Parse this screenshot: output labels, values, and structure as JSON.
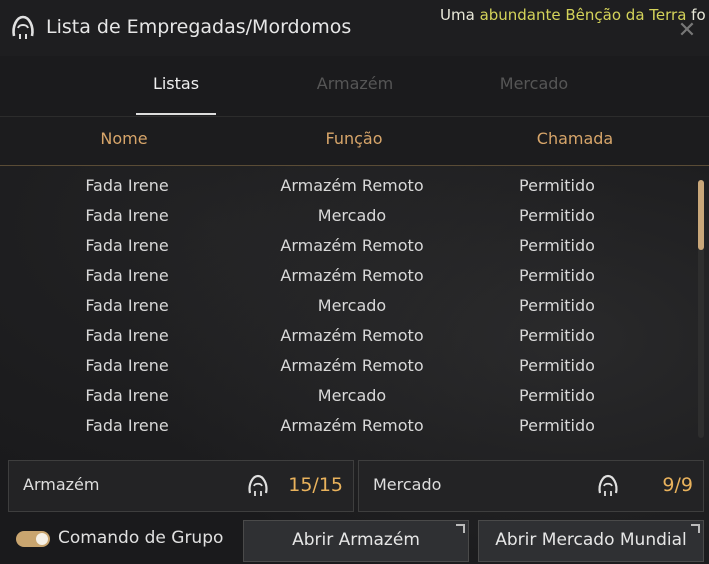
{
  "window": {
    "title": "Lista de Empregadas/Mordomos",
    "title_icon": "butler-icon",
    "close_icon": "close-icon"
  },
  "notice": {
    "prefix": "Uma ",
    "highlight": "abundante Bênção da Terra",
    "suffix": " fo"
  },
  "tabs": [
    {
      "label": "Listas",
      "active": true
    },
    {
      "label": "Armazém",
      "active": false
    },
    {
      "label": "Mercado",
      "active": false
    }
  ],
  "table": {
    "headers": [
      "Nome",
      "Função",
      "Chamada"
    ],
    "rows": [
      [
        "Fada Irene",
        "Armazém Remoto",
        "Permitido"
      ],
      [
        "Fada Irene",
        "Mercado",
        "Permitido"
      ],
      [
        "Fada Irene",
        "Armazém Remoto",
        "Permitido"
      ],
      [
        "Fada Irene",
        "Armazém Remoto",
        "Permitido"
      ],
      [
        "Fada Irene",
        "Mercado",
        "Permitido"
      ],
      [
        "Fada Irene",
        "Armazém Remoto",
        "Permitido"
      ],
      [
        "Fada Irene",
        "Armazém Remoto",
        "Permitido"
      ],
      [
        "Fada Irene",
        "Mercado",
        "Permitido"
      ],
      [
        "Fada Irene",
        "Armazém Remoto",
        "Permitido"
      ]
    ]
  },
  "stats": {
    "armazem": {
      "label": "Armazém",
      "value": "15/15",
      "icon": "butler-icon"
    },
    "mercado": {
      "label": "Mercado",
      "value": "9/9",
      "icon": "butler-icon"
    }
  },
  "footer": {
    "group_command_label": "Comando de Grupo",
    "group_command_on": true,
    "open_storage_label": "Abrir Armazém",
    "open_market_label": "Abrir Mercado Mundial"
  },
  "colors": {
    "accent": "#d7a56a",
    "value": "#e9b25c",
    "notice_highlight": "#d4d35a"
  }
}
